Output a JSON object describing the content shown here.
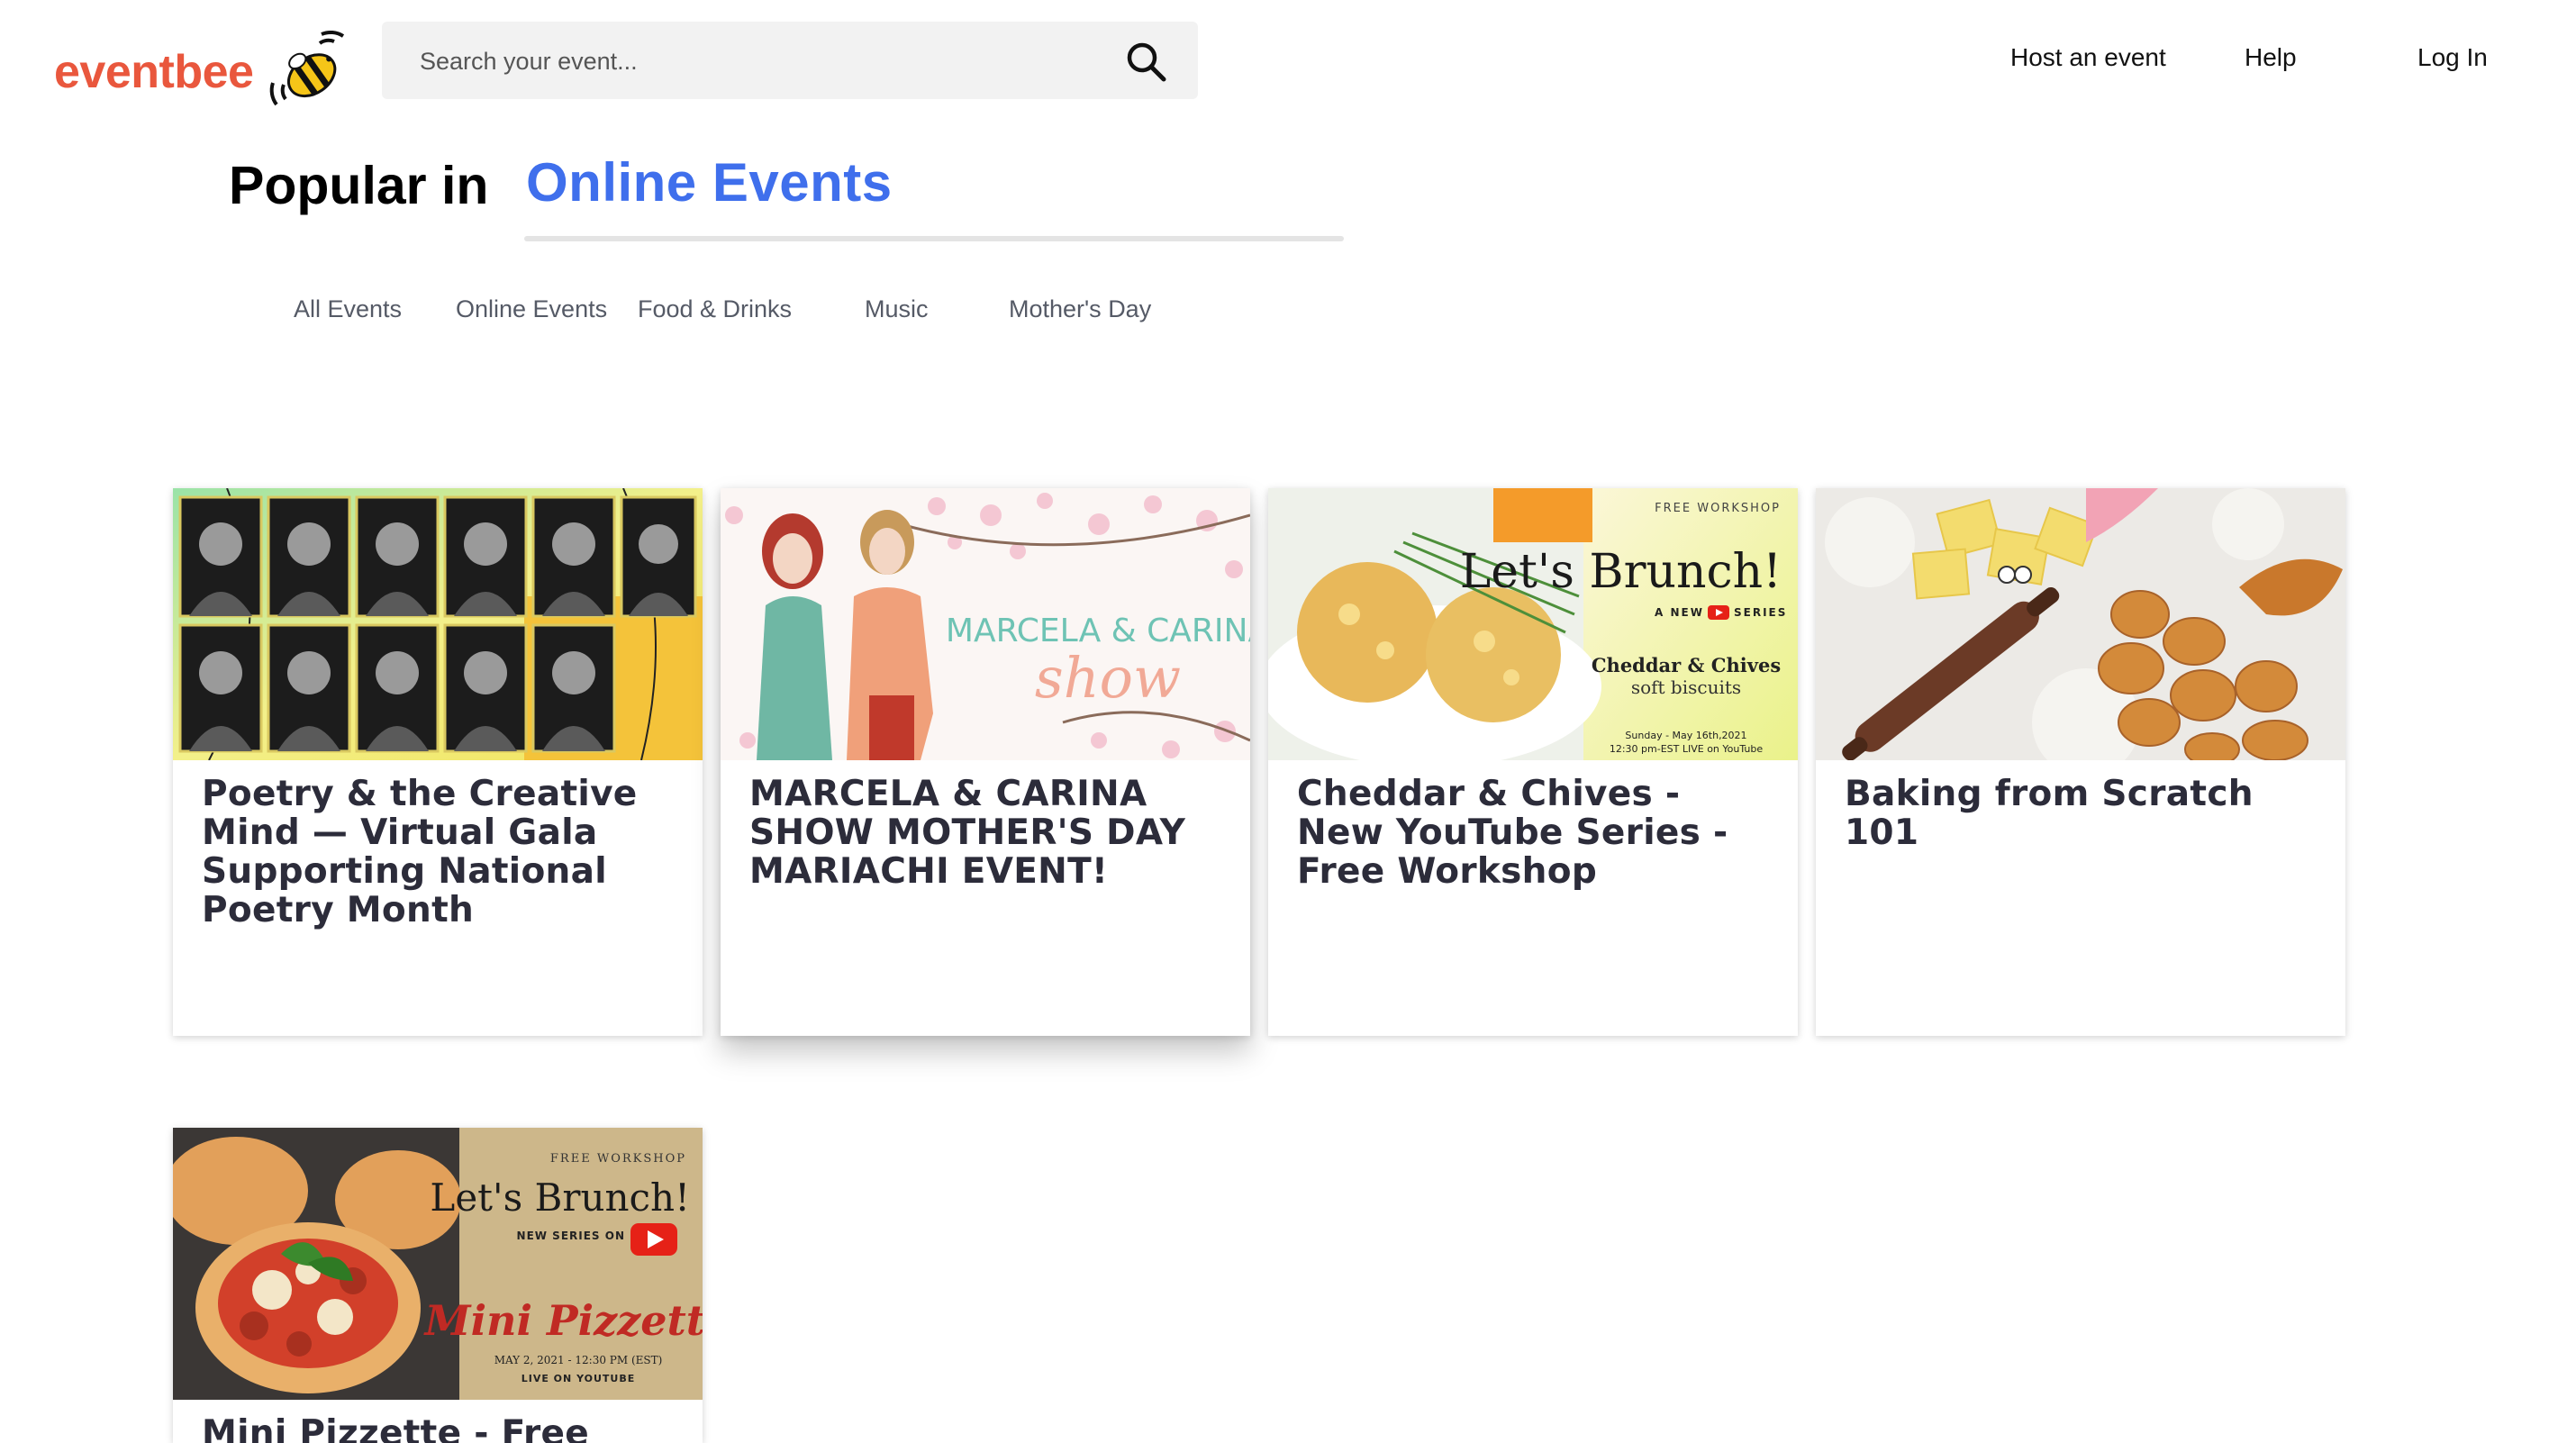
{
  "header": {
    "logo_text": "eventbee",
    "search_placeholder": "Search your event...",
    "nav": [
      "Host an event",
      "Help",
      "Log In"
    ]
  },
  "popular": {
    "label": "Popular in",
    "city": "Online Events"
  },
  "tabs": [
    "All Events",
    "Online Events",
    "Food & Drinks",
    "Music",
    "Mother's Day"
  ],
  "cards": [
    {
      "title": "Poetry & the Creative Mind — Virtual Gala Supporting National Poetry Month",
      "image": "poetry-gala-portraits"
    },
    {
      "title": "MARCELA & CARINA SHOW MOTHER'S DAY MARIACHI EVENT!",
      "image": "marcela-carina-illustration",
      "image_text": [
        "MARCELA & CARINA",
        "show"
      ]
    },
    {
      "title": "Cheddar & Chives - New YouTube Series - Free Workshop",
      "image": "cheddar-chives-biscuits",
      "image_text": [
        "FREE WORKSHOP",
        "Let's Brunch!",
        "A NEW",
        "SERIES",
        "Cheddar & Chives",
        "soft biscuits",
        "Sunday - May 16th,2021",
        "12:30 pm-EST LIVE on YouTube"
      ]
    },
    {
      "title": "Baking from Scratch 101",
      "image": "baking-butter-rolling-pin"
    },
    {
      "title": "Mini Pizzette - Free",
      "image": "mini-pizzette",
      "image_text": [
        "FREE WORKSHOP",
        "Let's Brunch!",
        "NEW SERIES ON",
        "Mini Pizzette",
        "MAY 2, 2021 - 12:30 PM (EST)",
        "LIVE ON YOUTUBE"
      ]
    }
  ],
  "colors": {
    "brand": "#e9573d",
    "accent": "#3f6fec",
    "bee_yellow": "#f5c518"
  }
}
